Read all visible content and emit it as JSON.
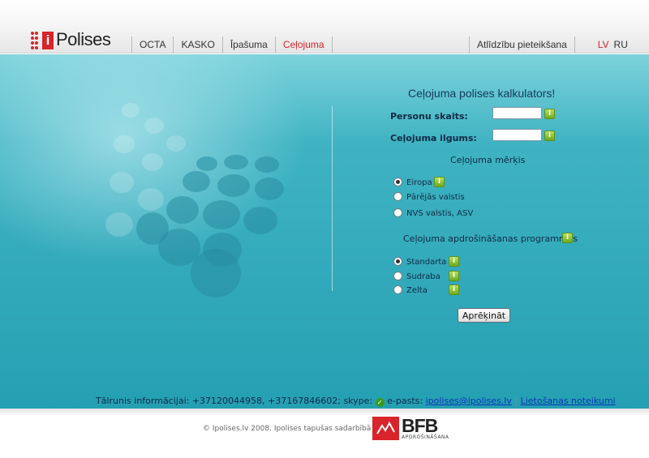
{
  "header": {
    "logo_letter": "i",
    "logo_text": "Polises",
    "nav": [
      "OCTA",
      "KASKO",
      "Īpašuma",
      "Ceļojuma"
    ],
    "claims_link": "Atlīdzību pieteikšana",
    "lang_lv": "LV",
    "lang_ru": "RU"
  },
  "form": {
    "title": "Ceļojuma polises kalkulators!",
    "persons_label": "Personu skaits:",
    "duration_label": "Ceļojuma ilgums:",
    "purpose_title": "Ceļojuma mērķis",
    "destinations": [
      "Eiropa",
      "Pārējās valstis",
      "NVS valstis, ASV"
    ],
    "selected_destination": "Eiropa",
    "programs_title": "Ceļojuma apdrošināšanas programmas",
    "programs": [
      "Standarta",
      "Sudraba",
      "Zelta"
    ],
    "selected_program": "Standarta",
    "calculate_button": "Aprēķināt",
    "info_icon": "info-icon"
  },
  "contact": {
    "phone_text": "Tālrunis informācijai: +37120044958, +37167846602; skype:",
    "email_prefix": "e-pasts:",
    "email": "ipolises@ipolises.lv",
    "separator": "|",
    "terms_link": "Lietošanas noteikumi"
  },
  "footer": {
    "copyright": "© Ipolises.lv 2008. Ipolises tapušas sadarbībā ar",
    "partner_logo": "BFB",
    "partner_sub": "APDROŠINĀŠANA"
  },
  "colors": {
    "accent": "#d8242b",
    "teal": "#2aa3b6",
    "link": "#0b37b0"
  }
}
